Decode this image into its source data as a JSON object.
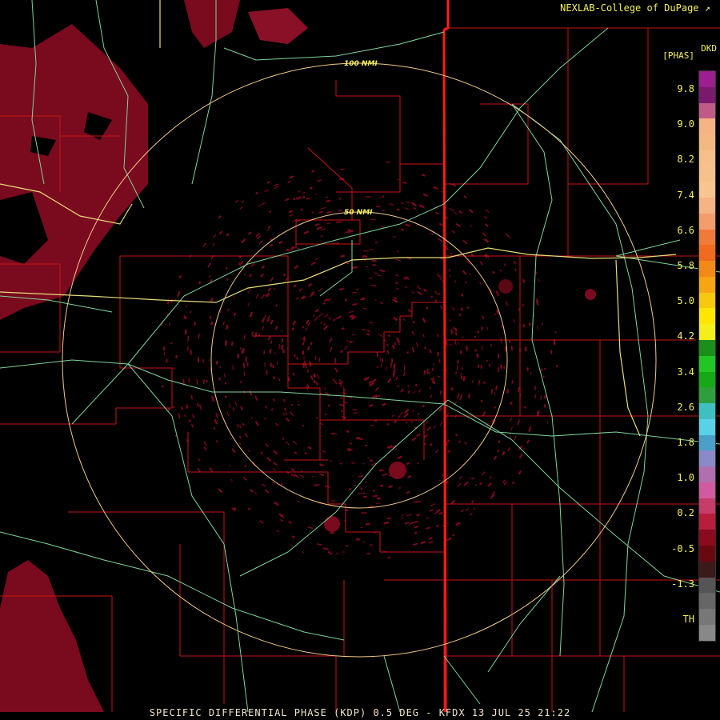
{
  "credit": "NEXLAB-College of DuPage",
  "product_header": {
    "code": "DKD",
    "unit": "[PHAS]"
  },
  "bottom_title": "SPECIFIC DIFFERENTIAL PHASE (KDP) 0.5 DEG - KFDX 13 JUL 25 21:22",
  "range_rings": [
    {
      "label": "100 NMI",
      "range_nmi": 100
    },
    {
      "label": "50 NMI",
      "range_nmi": 50
    }
  ],
  "colors": {
    "background": "#000000",
    "county_lines": "#c81414",
    "state_line": "#ff1a1a",
    "highways": "#7fd39a",
    "interstate": "#e6dd7a",
    "echo": "#7a0a1e"
  },
  "color_scale": {
    "labels": [
      "9.8",
      "9.0",
      "8.2",
      "7.4",
      "6.6",
      "5.8",
      "5.0",
      "4.2",
      "3.4",
      "2.6",
      "1.8",
      "1.0",
      "0.2",
      "-0.5",
      "-1.3",
      "TH"
    ],
    "segments": [
      "#9b1f8f",
      "#7a1a6c",
      "#c05a86",
      "#f6b383",
      "#f4b882",
      "#f7c08a",
      "#f6c28c",
      "#f8c590",
      "#f6b386",
      "#f29d6a",
      "#f07a3a",
      "#f06a20",
      "#f28a18",
      "#f6a612",
      "#f8c80e",
      "#ffe600",
      "#f4ee1a",
      "#1a8f1a",
      "#22c622",
      "#16a816",
      "#2f9e3c",
      "#3fc0c0",
      "#5ad2e6",
      "#4aa0c8",
      "#8a8ac8",
      "#b070b0",
      "#d25aa0",
      "#c83c6a",
      "#b81e3c",
      "#8a0a1e",
      "#6a0812",
      "#3a1a1a",
      "#555555",
      "#666666",
      "#777777",
      "#888888"
    ]
  }
}
